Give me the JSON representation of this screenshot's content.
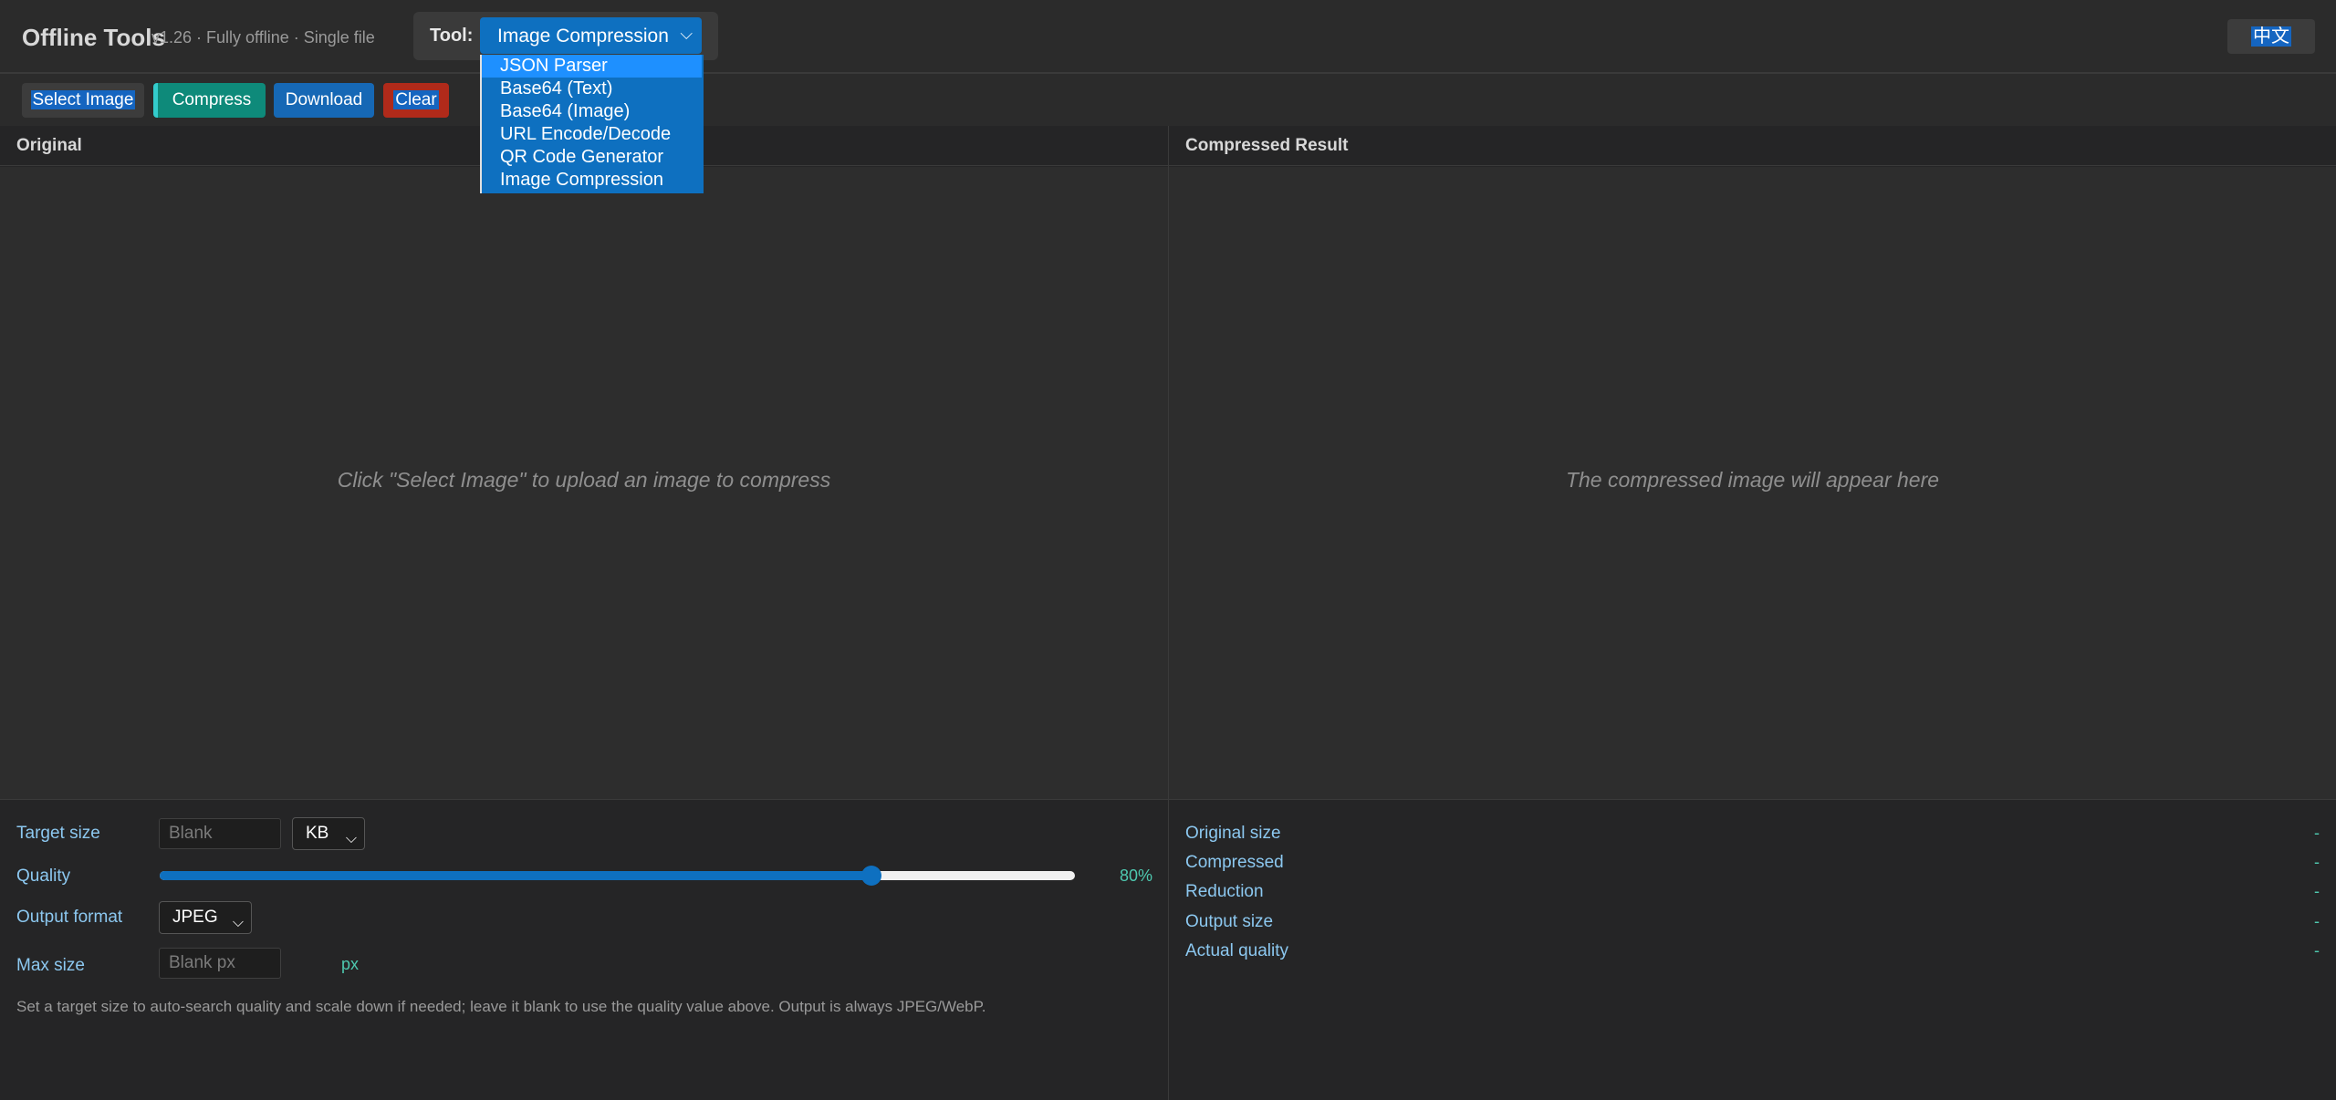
{
  "header": {
    "title": "Offline Tools",
    "version": "v1.26 · Fully offline · Single file",
    "tool_label": "Tool:",
    "tool_selected": "Image Compression",
    "language_button": "中文"
  },
  "tool_dropdown": {
    "options": [
      "JSON Parser",
      "Base64 (Text)",
      "Base64 (Image)",
      "URL Encode/Decode",
      "QR Code Generator",
      "Image Compression"
    ],
    "highlighted": "JSON Parser"
  },
  "toolbar": {
    "select_image": "Select Image",
    "compress": "Compress",
    "download": "Download",
    "clear": "Clear"
  },
  "panes": {
    "original_title": "Original",
    "result_title": "Compressed Result",
    "original_placeholder": "Click \"Select Image\" to upload an image to compress",
    "result_placeholder": "The compressed image will appear here"
  },
  "settings": {
    "target_size_label": "Target size",
    "target_size_placeholder": "Blank",
    "target_size_unit": "KB",
    "quality_label": "Quality",
    "quality_value": 80,
    "quality_text": "80%",
    "output_format_label": "Output format",
    "output_format_value": "JPEG",
    "max_size_label": "Max size",
    "max_size_placeholder": "Blank px",
    "max_size_unit": "px",
    "hint": "Set a target size to auto-search quality and scale down if needed; leave it blank to use the quality value above. Output is always JPEG/WebP."
  },
  "stats": [
    {
      "label": "Original size",
      "value": "-"
    },
    {
      "label": "Compressed",
      "value": "-"
    },
    {
      "label": "Reduction",
      "value": "-"
    },
    {
      "label": "Output size",
      "value": "-"
    },
    {
      "label": "Actual quality",
      "value": "-"
    }
  ],
  "colors": {
    "accent": "#0e70c0",
    "teal": "#4ec9b0",
    "danger": "#b02a1a",
    "compress": "#0e8a7a"
  }
}
